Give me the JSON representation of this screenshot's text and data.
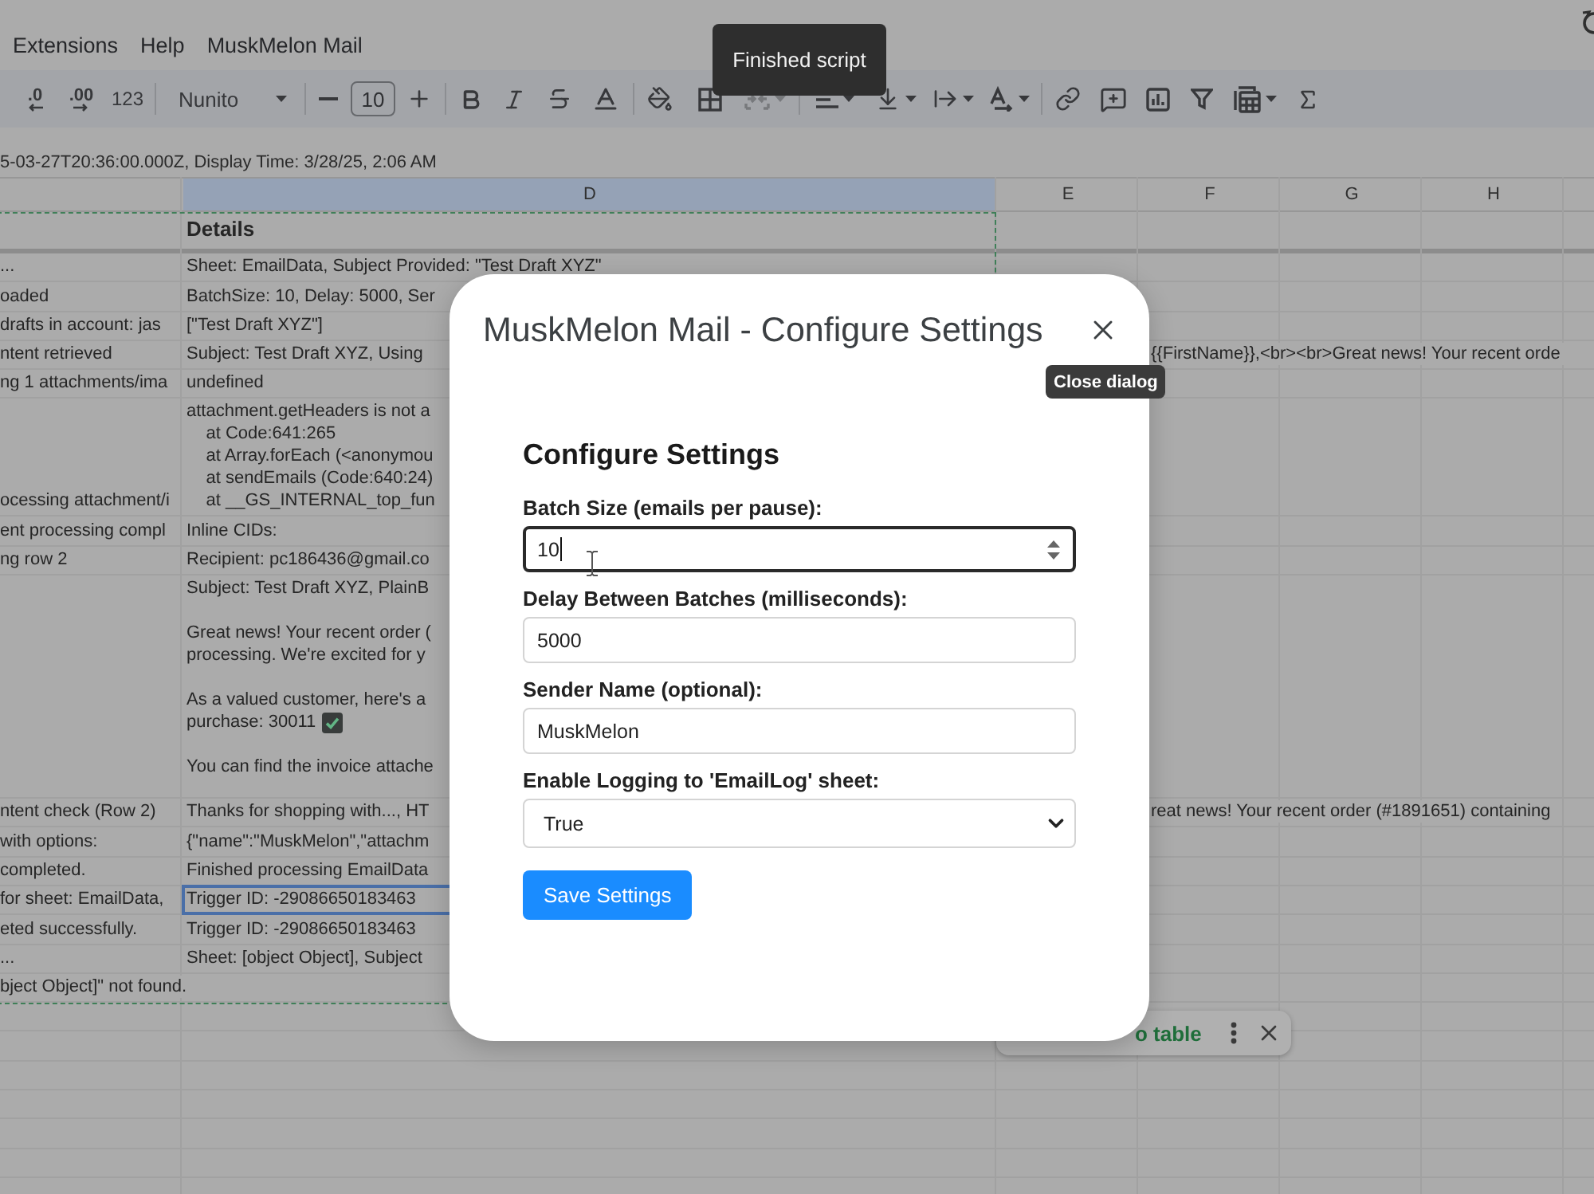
{
  "menu_bar": {
    "items": [
      "Extensions",
      "Help",
      "MuskMelon Mail"
    ]
  },
  "toolbar": {
    "items": [
      {
        "kind": "decrease-decimal",
        "label": ".0",
        "disabled": false,
        "menu": false
      },
      {
        "kind": "increase-decimal",
        "label": ".00",
        "disabled": false,
        "menu": false
      },
      {
        "kind": "number-format",
        "label": "123",
        "disabled": false,
        "menu": false
      },
      {
        "kind": "divider"
      },
      {
        "kind": "font",
        "label": "Nunito",
        "disabled": false,
        "menu": true
      },
      {
        "kind": "divider"
      },
      {
        "kind": "minus",
        "disabled": false,
        "menu": false
      },
      {
        "kind": "font-size",
        "value": "10",
        "disabled": false,
        "menu": false
      },
      {
        "kind": "plus",
        "disabled": false,
        "menu": false
      },
      {
        "kind": "divider"
      },
      {
        "kind": "bold",
        "disabled": false,
        "menu": false
      },
      {
        "kind": "italic",
        "disabled": false,
        "menu": false
      },
      {
        "kind": "strikethrough",
        "disabled": false,
        "menu": false
      },
      {
        "kind": "text-color",
        "disabled": false,
        "menu": false
      },
      {
        "kind": "divider"
      },
      {
        "kind": "fill-color",
        "disabled": false,
        "menu": false
      },
      {
        "kind": "borders",
        "disabled": false,
        "menu": false
      },
      {
        "kind": "merge",
        "disabled": true,
        "menu": true
      },
      {
        "kind": "divider"
      },
      {
        "kind": "align",
        "disabled": false,
        "menu": true
      },
      {
        "kind": "vertical-align",
        "disabled": false,
        "menu": true
      },
      {
        "kind": "wrap",
        "disabled": false,
        "menu": true
      },
      {
        "kind": "rotate",
        "disabled": false,
        "menu": true
      },
      {
        "kind": "divider"
      },
      {
        "kind": "link",
        "disabled": false,
        "menu": false
      },
      {
        "kind": "comment",
        "disabled": false,
        "menu": false
      },
      {
        "kind": "chart",
        "disabled": false,
        "menu": false
      },
      {
        "kind": "filter",
        "disabled": false,
        "menu": false
      },
      {
        "kind": "table",
        "disabled": false,
        "menu": true
      },
      {
        "kind": "sum",
        "disabled": false,
        "menu": false
      }
    ]
  },
  "status_toast": {
    "text": "Finished script"
  },
  "formula_bar": {
    "text": "5-03-27T20:36:00.000Z, Display Time: 3/28/25, 2:06 AM"
  },
  "sheet": {
    "columns": [
      {
        "letter": "D",
        "selected": true
      },
      {
        "letter": "E",
        "selected": false
      },
      {
        "letter": "F",
        "selected": false
      },
      {
        "letter": "G",
        "selected": false
      },
      {
        "letter": "H",
        "selected": false
      }
    ],
    "rows": [
      {
        "kind": "header",
        "details": "Details",
        "selected": false
      },
      {
        "kind": "text",
        "column_c": "...",
        "details": "Sheet: EmailData, Subject Provided: \"Test Draft XYZ\"",
        "selected": false
      },
      {
        "kind": "text",
        "column_c": "oaded",
        "details": "BatchSize: 10, Delay: 5000, Ser",
        "selected": false
      },
      {
        "kind": "text",
        "column_c": "drafts in account: jas",
        "details": "[\"Test Draft XYZ\"]",
        "selected": false
      },
      {
        "kind": "text",
        "column_c": "ntent retrieved",
        "details": "Subject: Test Draft XYZ, Using",
        "overflow_text": "{{FirstName}},<br><br>Great news! Your recent orde",
        "selected": false
      },
      {
        "kind": "text",
        "column_c": "ng 1 attachments/ima",
        "details": "undefined",
        "selected": false
      },
      {
        "kind": "text",
        "column_c": "ocessing attachment/i",
        "details": "attachment.getHeaders is not a\n    at Code:641:265\n    at Array.forEach (<anonymou\n    at sendEmails (Code:640:24)\n    at __GS_INTERNAL_top_fun",
        "selected": false
      },
      {
        "kind": "text",
        "column_c": "ent processing compl",
        "details": "Inline CIDs:",
        "selected": false
      },
      {
        "kind": "text",
        "column_c": "ng row 2",
        "details": "Recipient: pc186436@gmail.co",
        "selected": false
      },
      {
        "kind": "message",
        "paragraphs": [
          {
            "lines": [
              "Subject: Test Draft XYZ, PlainB"
            ],
            "check_mark": false
          },
          {
            "lines": [
              "Great news! Your recent order (",
              "processing. We're excited for y"
            ],
            "check_mark": false
          },
          {
            "lines": [
              "As a valued customer, here's a",
              "purchase: 30011"
            ],
            "check_mark": true
          },
          {
            "lines": [
              "You can find the invoice attache"
            ],
            "check_mark": false
          }
        ],
        "selected": false
      },
      {
        "kind": "text",
        "column_c": "ntent check (Row 2)",
        "details": "Thanks for shopping with..., HT",
        "overflow_text": "reat news! Your recent order (#1891651) containing",
        "selected": false
      },
      {
        "kind": "text",
        "column_c": "with options:",
        "details": "{\"name\":\"MuskMelon\",\"attachm",
        "selected": false
      },
      {
        "kind": "text",
        "column_c": "completed.",
        "details": "Finished processing EmailData",
        "selected": false
      },
      {
        "kind": "text",
        "column_c": "for sheet: EmailData,",
        "details": "Trigger ID: -29086650183463",
        "selected": true
      },
      {
        "kind": "text",
        "column_c": "eted successfully.",
        "details": "Trigger ID: -29086650183463",
        "selected": false
      },
      {
        "kind": "text",
        "column_c": "...",
        "details": "Sheet: [object Object], Subject",
        "selected": false
      },
      {
        "kind": "text",
        "column_c": "bject Object]\" not found.",
        "selected": false
      }
    ]
  },
  "suggestion_chip": {
    "label": "o table"
  },
  "dialog": {
    "title": "MuskMelon Mail - Configure Settings",
    "close_tooltip": "Close dialog",
    "heading": "Configure Settings",
    "fields": [
      {
        "kind": "number",
        "label": "Batch Size (emails per pause):",
        "value": "10",
        "focused": true
      },
      {
        "kind": "number",
        "label": "Delay Between Batches (milliseconds):",
        "value": "5000",
        "focused": false
      },
      {
        "kind": "text",
        "label": "Sender Name (optional):",
        "value": "MuskMelon",
        "focused": false
      },
      {
        "kind": "select",
        "label": "Enable Logging to 'EmailLog' sheet:",
        "value": "True",
        "focused": false
      }
    ],
    "save_button": "Save Settings"
  }
}
